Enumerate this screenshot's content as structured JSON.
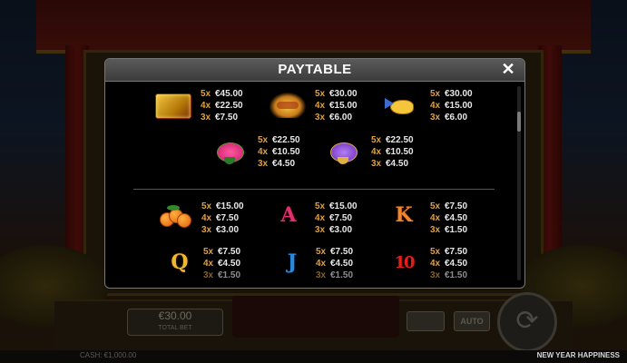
{
  "modal": {
    "title": "PAYTABLE",
    "close_icon": "close-icon"
  },
  "hud": {
    "credit_value": "€30.00",
    "credit_label": "TOTAL BET",
    "auto_label": "AUTO",
    "footer_cash": "CASH: €1,000.00",
    "game_title": "NEW YEAR HAPPINESS"
  },
  "symbols": [
    {
      "id": "gold-bar",
      "pays": [
        {
          "m": "5x",
          "v": "€45.00"
        },
        {
          "m": "4x",
          "v": "€22.50"
        },
        {
          "m": "3x",
          "v": "€7.50"
        }
      ]
    },
    {
      "id": "dragon",
      "pays": [
        {
          "m": "5x",
          "v": "€30.00"
        },
        {
          "m": "4x",
          "v": "€15.00"
        },
        {
          "m": "3x",
          "v": "€6.00"
        }
      ]
    },
    {
      "id": "golden-fish",
      "pays": [
        {
          "m": "5x",
          "v": "€30.00"
        },
        {
          "m": "4x",
          "v": "€15.00"
        },
        {
          "m": "3x",
          "v": "€6.00"
        }
      ]
    },
    {
      "id": "pink-pouch",
      "pays": [
        {
          "m": "5x",
          "v": "€22.50"
        },
        {
          "m": "4x",
          "v": "€10.50"
        },
        {
          "m": "3x",
          "v": "€4.50"
        }
      ]
    },
    {
      "id": "purple-pouch",
      "pays": [
        {
          "m": "5x",
          "v": "€22.50"
        },
        {
          "m": "4x",
          "v": "€10.50"
        },
        {
          "m": "3x",
          "v": "€4.50"
        }
      ]
    },
    {
      "id": "oranges",
      "pays": [
        {
          "m": "5x",
          "v": "€15.00"
        },
        {
          "m": "4x",
          "v": "€7.50"
        },
        {
          "m": "3x",
          "v": "€3.00"
        }
      ]
    },
    {
      "id": "letter-a",
      "glyph": "A",
      "pays": [
        {
          "m": "5x",
          "v": "€15.00"
        },
        {
          "m": "4x",
          "v": "€7.50"
        },
        {
          "m": "3x",
          "v": "€3.00"
        }
      ]
    },
    {
      "id": "letter-k",
      "glyph": "K",
      "pays": [
        {
          "m": "5x",
          "v": "€7.50"
        },
        {
          "m": "4x",
          "v": "€4.50"
        },
        {
          "m": "3x",
          "v": "€1.50"
        }
      ]
    },
    {
      "id": "letter-q",
      "glyph": "Q",
      "pays": [
        {
          "m": "5x",
          "v": "€7.50"
        },
        {
          "m": "4x",
          "v": "€4.50"
        },
        {
          "m": "3x",
          "v": "€1.50"
        }
      ]
    },
    {
      "id": "letter-j",
      "glyph": "J",
      "pays": [
        {
          "m": "5x",
          "v": "€7.50"
        },
        {
          "m": "4x",
          "v": "€4.50"
        },
        {
          "m": "3x",
          "v": "€1.50"
        }
      ]
    },
    {
      "id": "number-10",
      "glyph": "10",
      "pays": [
        {
          "m": "5x",
          "v": "€7.50"
        },
        {
          "m": "4x",
          "v": "€4.50"
        },
        {
          "m": "3x",
          "v": "€1.50"
        }
      ]
    }
  ]
}
